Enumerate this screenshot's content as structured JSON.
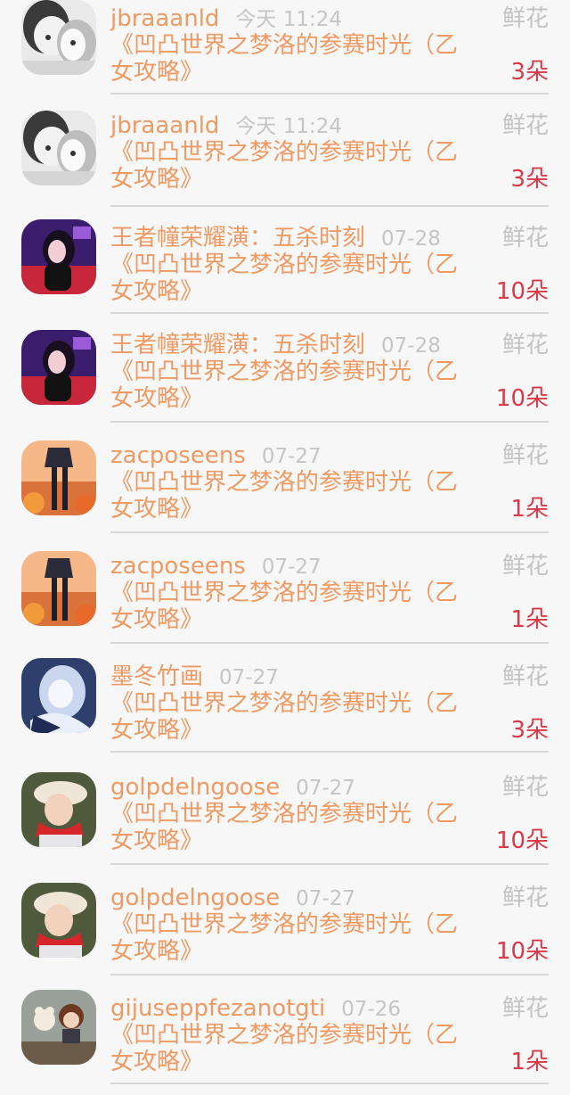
{
  "records": [
    {
      "user": "jbraaanld",
      "time": "今天 11:24",
      "gift_label": "鲜花",
      "work": "《凹凸世界之梦洛的参赛时光（乙女攻略》",
      "count": "3朵",
      "avatar": "bw-portrait"
    },
    {
      "user": "jbraaanld",
      "time": "今天 11:24",
      "gift_label": "鲜花",
      "work": "《凹凸世界之梦洛的参赛时光（乙女攻略》",
      "count": "3朵",
      "avatar": "bw-portrait"
    },
    {
      "user": "王者幢荣耀潢：五杀时刻",
      "time": "07-28",
      "gift_label": "鲜花",
      "work": "《凹凸世界之梦洛的参赛时光（乙女攻略》",
      "count": "10朵",
      "avatar": "neon-girl"
    },
    {
      "user": "王者幢荣耀潢：五杀时刻",
      "time": "07-28",
      "gift_label": "鲜花",
      "work": "《凹凸世界之梦洛的参赛时光（乙女攻略》",
      "count": "10朵",
      "avatar": "neon-girl"
    },
    {
      "user": "zacposeens",
      "time": "07-27",
      "gift_label": "鲜花",
      "work": "《凹凸世界之梦洛的参赛时光（乙女攻略》",
      "count": "1朵",
      "avatar": "sunset-anime"
    },
    {
      "user": "zacposeens",
      "time": "07-27",
      "gift_label": "鲜花",
      "work": "《凹凸世界之梦洛的参赛时光（乙女攻略》",
      "count": "1朵",
      "avatar": "sunset-anime"
    },
    {
      "user": "墨冬竹画",
      "time": "07-27",
      "gift_label": "鲜花",
      "work": "《凹凸世界之梦洛的参赛时光（乙女攻略》",
      "count": "3朵",
      "avatar": "blue-anime"
    },
    {
      "user": "golpdelngoose",
      "time": "07-27",
      "gift_label": "鲜花",
      "work": "《凹凸世界之梦洛的参赛时光（乙女攻略》",
      "count": "10朵",
      "avatar": "child-beret"
    },
    {
      "user": "golpdelngoose",
      "time": "07-27",
      "gift_label": "鲜花",
      "work": "《凹凸世界之梦洛的参赛时光（乙女攻略》",
      "count": "10朵",
      "avatar": "child-beret"
    },
    {
      "user": "gijuseppfezanotgti",
      "time": "07-26",
      "gift_label": "鲜花",
      "work": "《凹凸世界之梦洛的参赛时光（乙女攻略》",
      "count": "1朵",
      "avatar": "dolls-bench"
    }
  ]
}
